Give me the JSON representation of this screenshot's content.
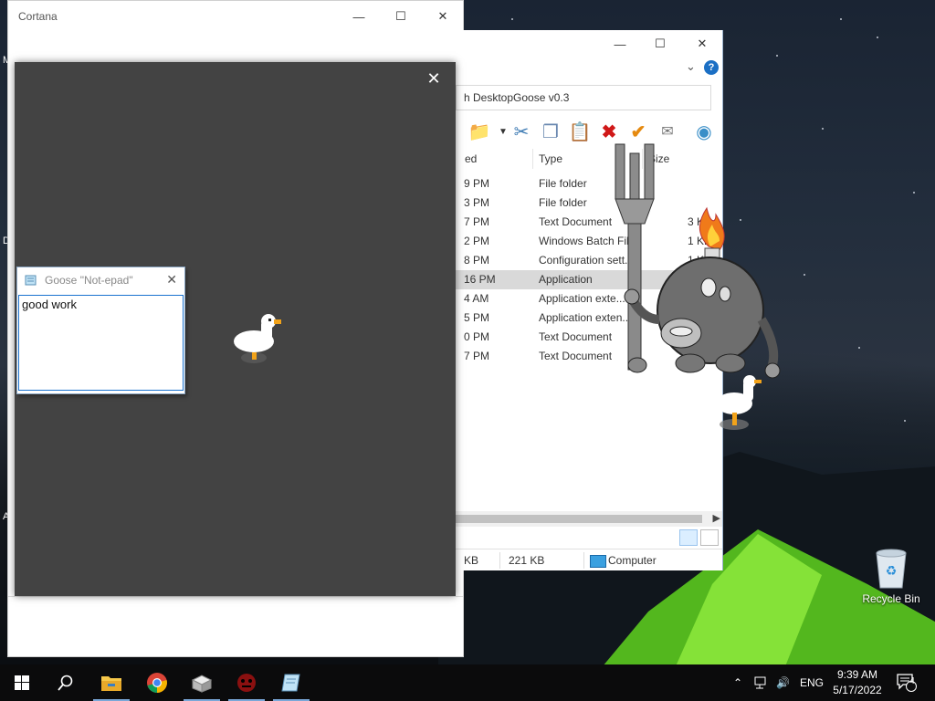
{
  "cortana": {
    "title": "Cortana"
  },
  "explorer": {
    "address": "h DesktopGoose v0.3",
    "columns": {
      "modified": "ed",
      "type": "Type",
      "size": "Size"
    },
    "rows": [
      {
        "modified": "9 PM",
        "type": "File folder",
        "size": ""
      },
      {
        "modified": "3 PM",
        "type": "File folder",
        "size": ""
      },
      {
        "modified": "7 PM",
        "type": "Text Document",
        "size": "3 KB"
      },
      {
        "modified": "2 PM",
        "type": "Windows Batch File",
        "size": "1 KB"
      },
      {
        "modified": "8 PM",
        "type": "Configuration sett...",
        "size": "1 KB"
      },
      {
        "modified": "16 PM",
        "type": "Application",
        "size": "221"
      },
      {
        "modified": "4 AM",
        "type": "Application exte...",
        "size": ""
      },
      {
        "modified": "5 PM",
        "type": "Application exten...",
        "size": ""
      },
      {
        "modified": "0 PM",
        "type": "Text Document",
        "size": ""
      },
      {
        "modified": "7 PM",
        "type": "Text Document",
        "size": ""
      }
    ],
    "status": {
      "left": "KB",
      "size": "221 KB",
      "location": "Computer"
    }
  },
  "notepad": {
    "title": "Goose \"Not-epad\"",
    "text": "good work"
  },
  "desktop": {
    "recycle_bin": "Recycle Bin"
  },
  "taskbar": {
    "language": "ENG",
    "time": "9:39 AM",
    "date": "5/17/2022",
    "notification_count": "4"
  },
  "colors": {
    "accent": "#1a73d0",
    "dialog_bg": "#434343",
    "taskbar": "#0b0b0c"
  }
}
